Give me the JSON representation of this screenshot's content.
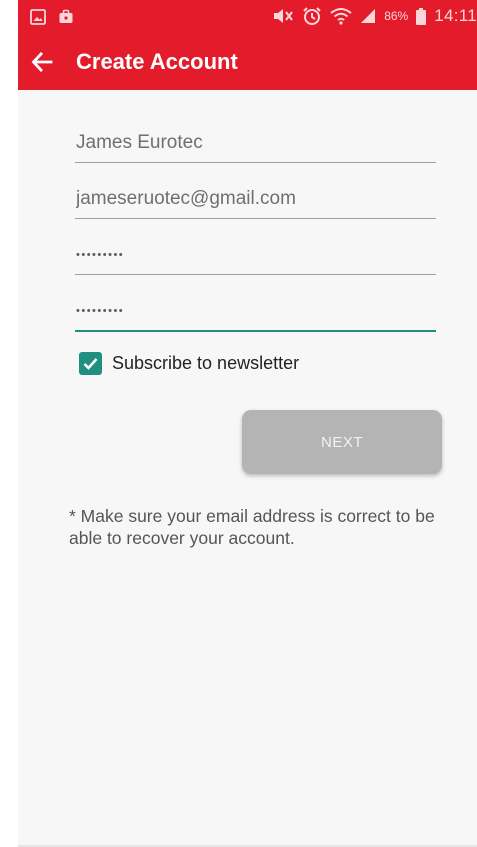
{
  "status_bar": {
    "battery_percent": "86%",
    "time": "14:11",
    "icons": [
      "image-icon",
      "briefcase-icon",
      "mute-icon",
      "alarm-icon",
      "wifi-icon",
      "signal-icon",
      "battery-icon"
    ]
  },
  "app_bar": {
    "back_icon": "back-arrow-icon",
    "title": "Create Account"
  },
  "form": {
    "name_value": "James Eurotec",
    "email_value": "jameseruotec@gmail.com",
    "password_value": "•••••••••",
    "confirm_password_value": "•••••••••",
    "newsletter_checked": true,
    "newsletter_label": "Subscribe to newsletter",
    "next_label": "NEXT"
  },
  "note": "* Make sure your email address is correct to be able to recover your account.",
  "colors": {
    "primary": "#e41b2a",
    "accent": "#1f9080",
    "button_disabled": "#b4b4b4"
  }
}
